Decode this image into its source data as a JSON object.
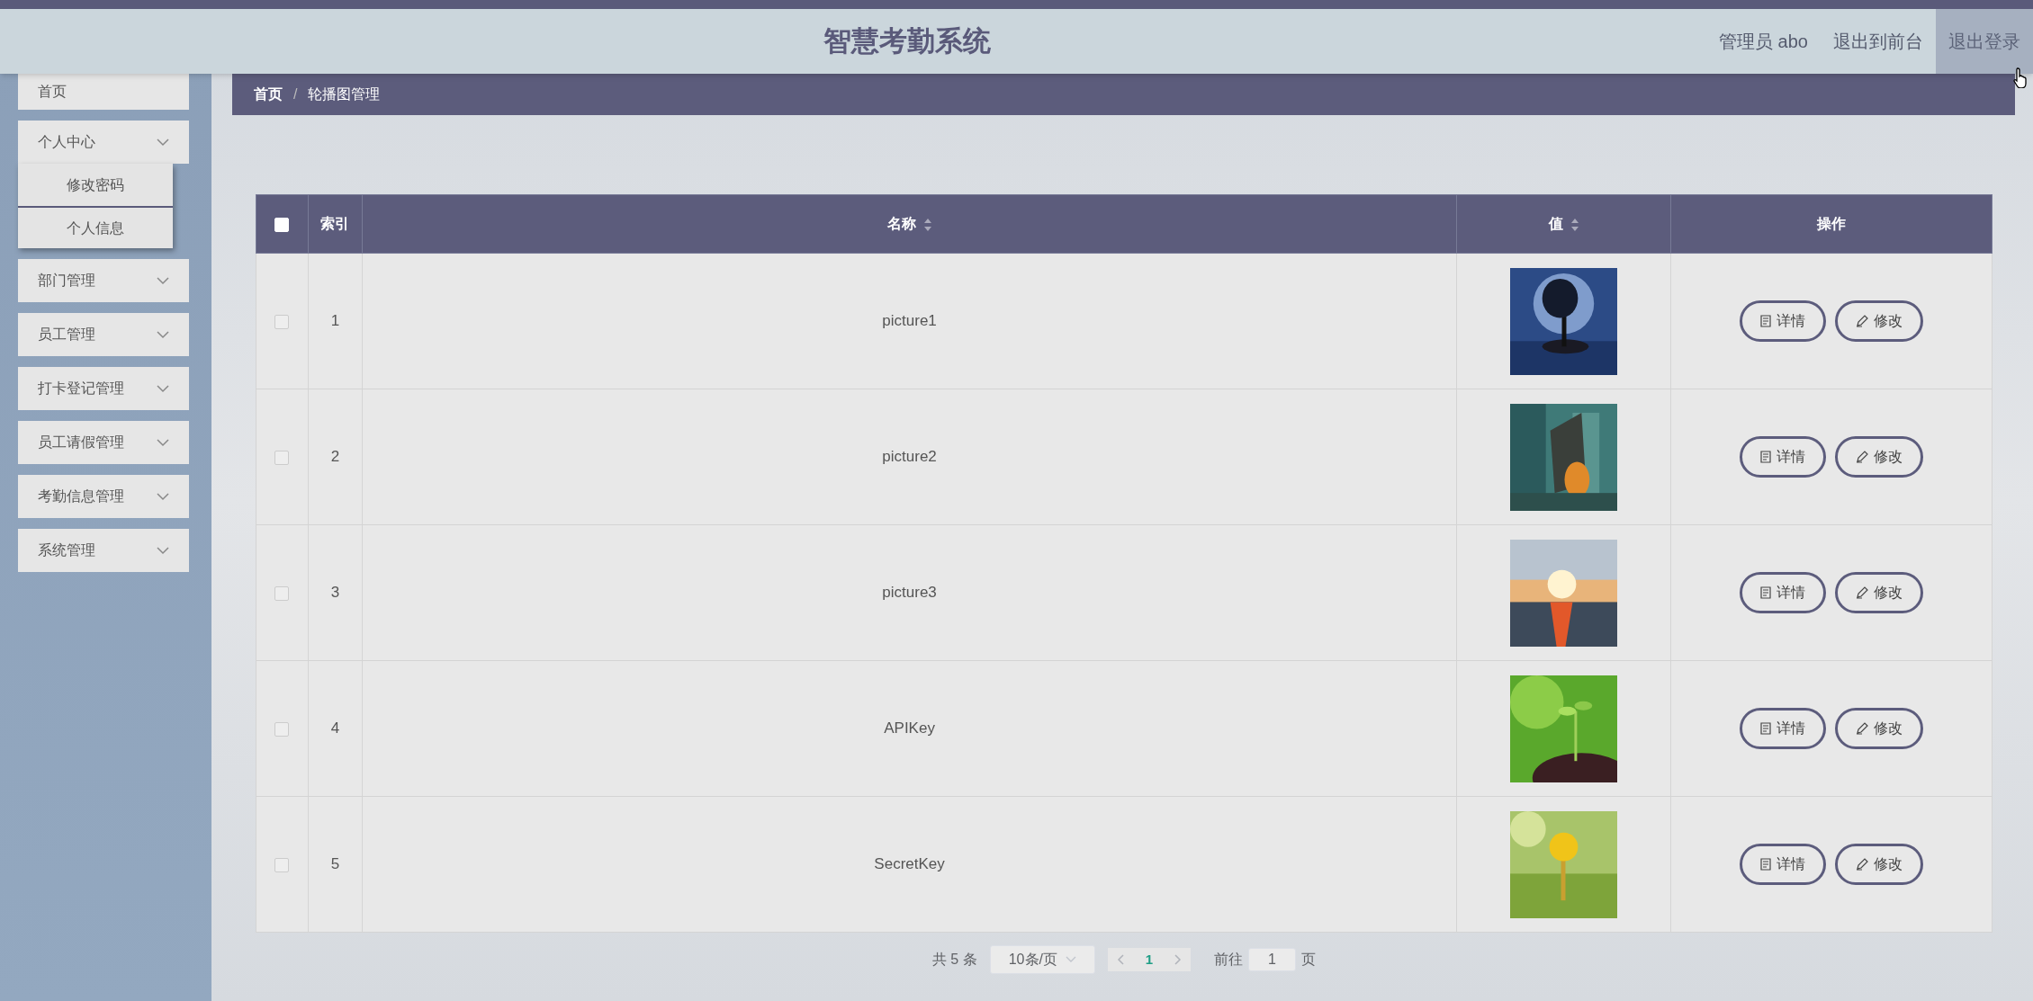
{
  "header": {
    "title": "智慧考勤系统",
    "nav": [
      {
        "label": "管理员 abo",
        "selected": false
      },
      {
        "label": "退出到前台",
        "selected": false
      },
      {
        "label": "退出登录",
        "selected": true
      }
    ]
  },
  "sidebar": {
    "items": [
      {
        "label": "首页",
        "kind": "link"
      },
      {
        "label": "个人中心",
        "kind": "menu",
        "children": [
          {
            "label": "修改密码"
          },
          {
            "label": "个人信息"
          }
        ]
      },
      {
        "label": "部门管理",
        "kind": "menu"
      },
      {
        "label": "员工管理",
        "kind": "menu"
      },
      {
        "label": "打卡登记管理",
        "kind": "menu"
      },
      {
        "label": "员工请假管理",
        "kind": "menu"
      },
      {
        "label": "考勤信息管理",
        "kind": "menu"
      },
      {
        "label": "系统管理",
        "kind": "menu"
      }
    ]
  },
  "breadcrumb": {
    "items": [
      "首页",
      "轮播图管理"
    ],
    "separator": "/"
  },
  "table": {
    "select_all": {
      "checked": false
    },
    "columns": [
      {
        "label": "索引",
        "sortable": false
      },
      {
        "label": "名称",
        "sortable": true
      },
      {
        "label": "值",
        "sortable": true
      },
      {
        "label": "操作",
        "sortable": false
      }
    ],
    "rows": [
      {
        "checked": false,
        "index": "1",
        "name": "picture1",
        "value": {
          "kind": "picture"
        },
        "actions": [
          "详情",
          "修改"
        ]
      },
      {
        "checked": false,
        "index": "2",
        "name": "picture2",
        "value": {
          "kind": "picture"
        },
        "actions": [
          "详情",
          "修改"
        ]
      },
      {
        "checked": false,
        "index": "3",
        "name": "picture3",
        "value": {
          "kind": "picture"
        },
        "actions": [
          "详情",
          "修改"
        ]
      },
      {
        "checked": false,
        "index": "4",
        "name": "APIKey",
        "value": {
          "kind": "picture"
        },
        "actions": [
          "详情",
          "修改"
        ]
      },
      {
        "checked": false,
        "index": "5",
        "name": "SecretKey",
        "value": {
          "kind": "picture"
        },
        "actions": [
          "详情",
          "修改"
        ]
      }
    ]
  },
  "pagination": {
    "total": "共 5 条",
    "page_size": "10条/页",
    "pages": [
      {
        "label": "1",
        "selected": true
      }
    ],
    "goto_label": "前往",
    "goto_value": "1",
    "goto_suffix": "页"
  }
}
